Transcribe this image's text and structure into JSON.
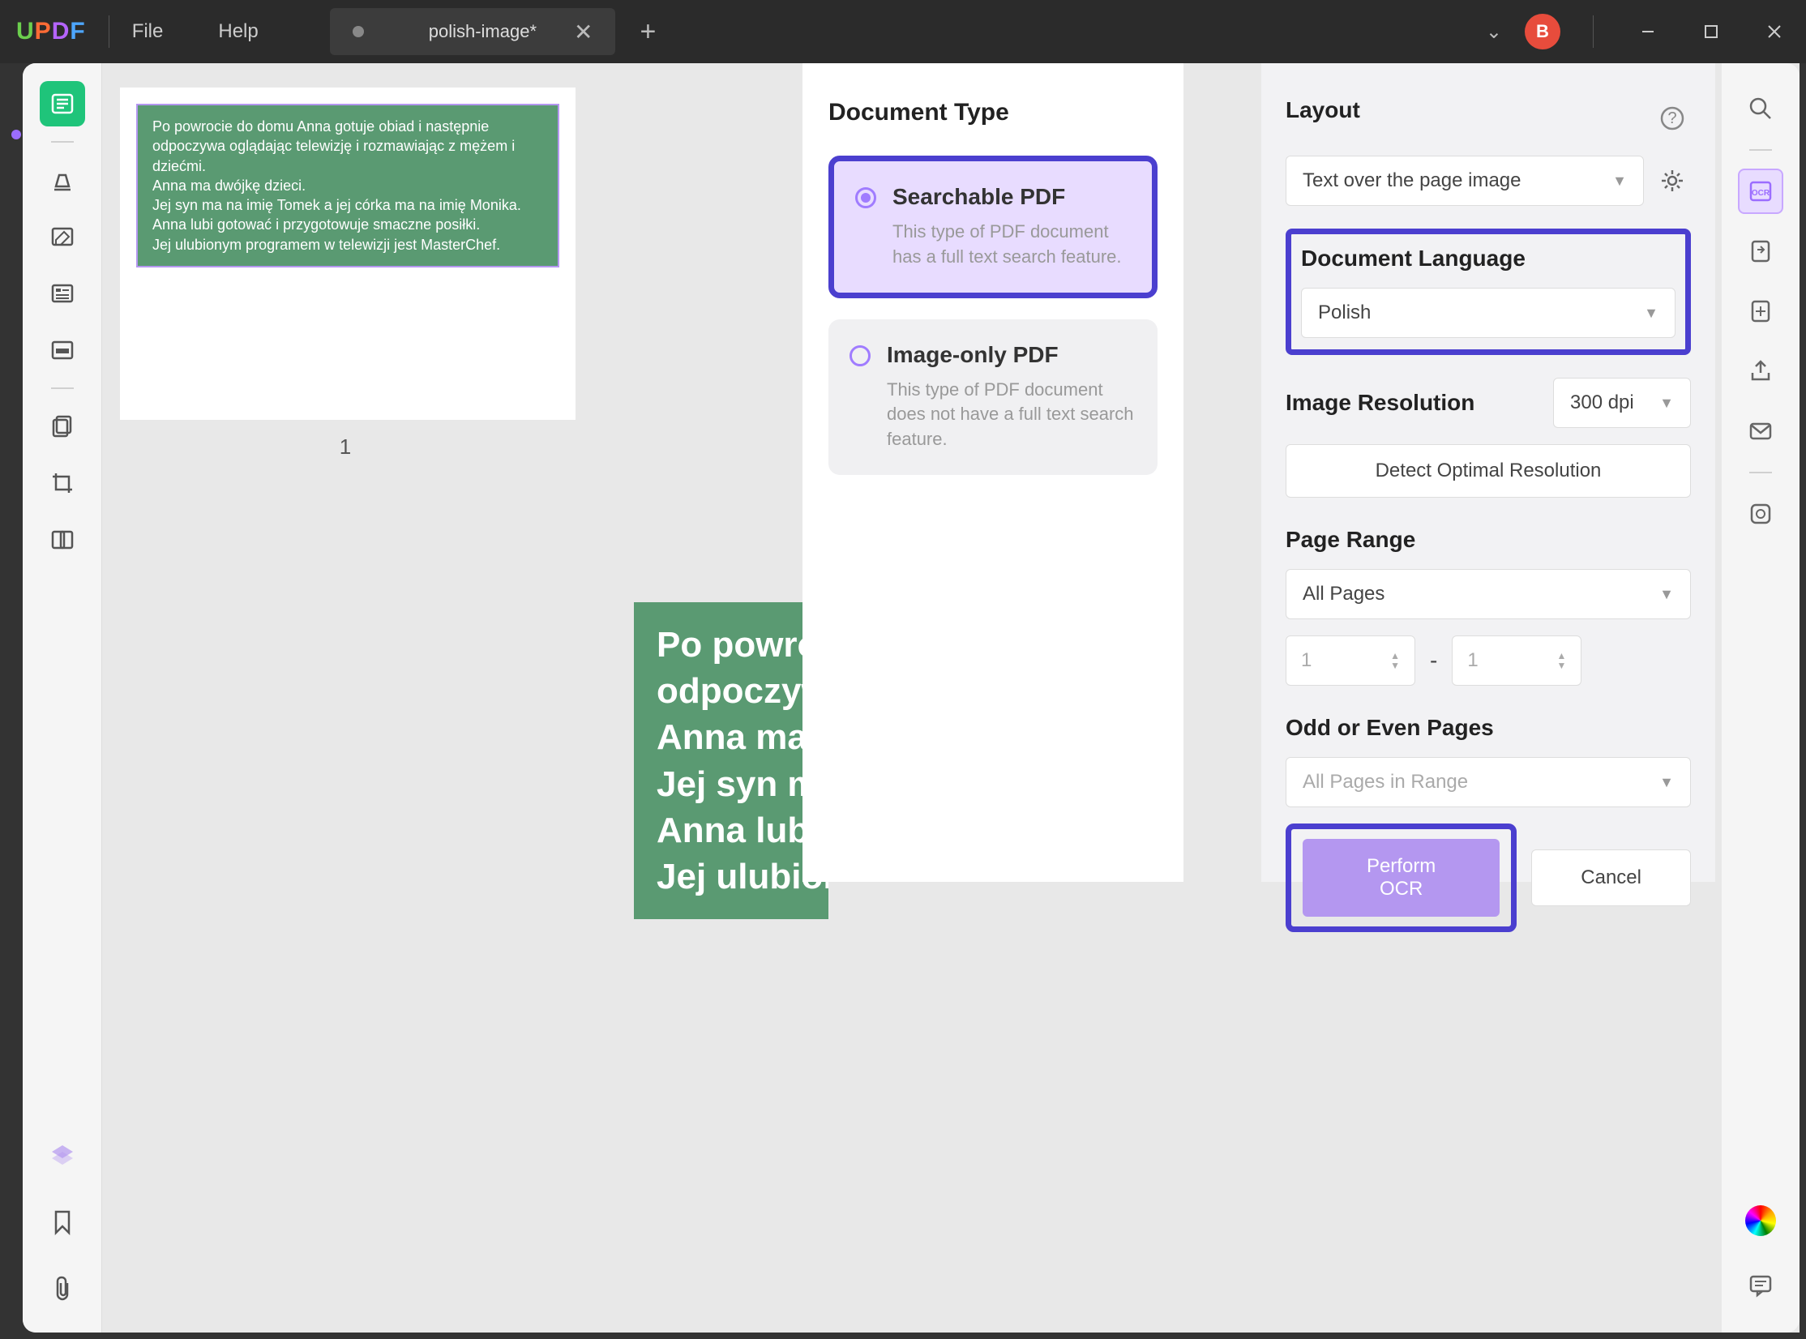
{
  "titlebar": {
    "logo_u": "U",
    "logo_p": "P",
    "logo_d": "D",
    "logo_f": "F",
    "menu_file": "File",
    "menu_help": "Help",
    "tab_title": "polish-image*",
    "avatar_letter": "B"
  },
  "thumbnail": {
    "page_number": "1",
    "text_lines": [
      "Po powrocie do domu Anna gotuje obiad i następnie",
      "odpoczywa oglądając telewizję i rozmawiając z mężem i dziećmi.",
      "Anna ma dwójkę dzieci.",
      "Jej syn ma na imię Tomek a jej córka ma na imię Monika.",
      "Anna lubi gotować i przygotowuje smaczne posiłki.",
      "Jej ulubionym programem w telewizji jest MasterChef."
    ]
  },
  "main_preview_lines": [
    "Po powrocie",
    "odpoczywa",
    "Anna ma dw",
    "Jej syn ma n",
    "Anna lubi go",
    "Jej ulubiony"
  ],
  "doc_type": {
    "heading": "Document Type",
    "searchable_title": "Searchable PDF",
    "searchable_desc": "This type of PDF document has a full text search feature.",
    "image_title": "Image-only PDF",
    "image_desc": "This type of PDF document does not have a full text search feature."
  },
  "ocr": {
    "layout_label": "Layout",
    "layout_value": "Text over the page image",
    "lang_label": "Document Language",
    "lang_value": "Polish",
    "res_label": "Image Resolution",
    "res_value": "300 dpi",
    "detect_btn": "Detect Optimal Resolution",
    "range_label": "Page Range",
    "range_value": "All Pages",
    "range_from": "1",
    "range_to": "1",
    "range_dash": "-",
    "odd_even_label": "Odd or Even Pages",
    "odd_even_value": "All Pages in Range",
    "perform_btn": "Perform OCR",
    "cancel_btn": "Cancel"
  }
}
